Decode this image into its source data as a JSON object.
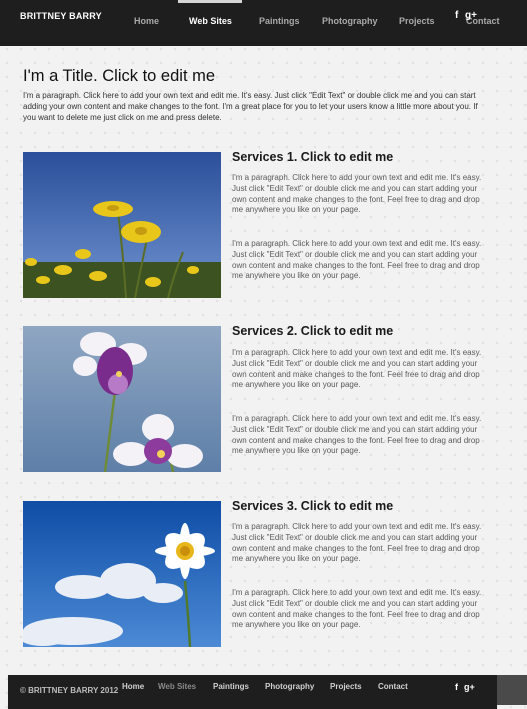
{
  "header": {
    "brand": "BRITTNEY BARRY",
    "nav": [
      "Home",
      "Web Sites",
      "Paintings",
      "Photography",
      "Projects",
      "Contact"
    ],
    "active_index": 1
  },
  "social": {
    "facebook": "f",
    "gplus": "g+"
  },
  "intro": {
    "title": "I'm a Title. Click to edit me",
    "text": "I'm a paragraph. Click here to add your own text and edit me. It's easy. Just click \"Edit Text\" or double click me and you can start adding your own content and make changes to the font. I'm a great place for you to let your users know a little more about you. If you want to delete me just click on me and press delete."
  },
  "services": [
    {
      "title": "Services 1. Click to edit me",
      "paragraphs": [
        "I'm a paragraph. Click here to add your own text and edit me. It's easy. Just click \"Edit Text\" or double click me and you can start adding your own content and make changes to the font. Feel free to drag and drop me anywhere you like on your page.",
        "I'm a paragraph. Click here to add your own text and edit me. It's easy. Just click \"Edit Text\" or double click me and you can start adding your own content and make changes to the font. Feel free to drag and drop me anywhere you like on your page."
      ]
    },
    {
      "title": "Services 2. Click to edit me",
      "paragraphs": [
        "I'm a paragraph. Click here to add your own text and edit me. It's easy. Just click \"Edit Text\" or double click me and you can start adding your own content and make changes to the font. Feel free to drag and drop me anywhere you like on your page.",
        "I'm a paragraph. Click here to add your own text and edit me. It's easy. Just click \"Edit Text\" or double click me and you can start adding your own content and make changes to the font. Feel free to drag and drop me anywhere you like on your page."
      ]
    },
    {
      "title": "Services 3. Click to edit me",
      "paragraphs": [
        "I'm a paragraph. Click here to add your own text and edit me. It's easy. Just click \"Edit Text\" or double click me and you can start adding your own content and make changes to the font. Feel free to drag and drop me anywhere you like on your page.",
        "I'm a paragraph. Click here to add your own text and edit me. It's easy. Just click \"Edit Text\" or double click me and you can start adding your own content and make changes to the font. Feel free to drag and drop me anywhere you like on your page."
      ]
    }
  ],
  "footer": {
    "copyright": "© BRITTNEY BARRY 2012",
    "nav": [
      "Home",
      "Web Sites",
      "Paintings",
      "Photography",
      "Projects",
      "Contact"
    ]
  },
  "colors": {
    "header_bg": "#1e1e1e",
    "page_bg": "#f2f2f2",
    "footer_accent": "#4a4a4a"
  },
  "icons": [
    "facebook-icon",
    "google-plus-icon"
  ]
}
